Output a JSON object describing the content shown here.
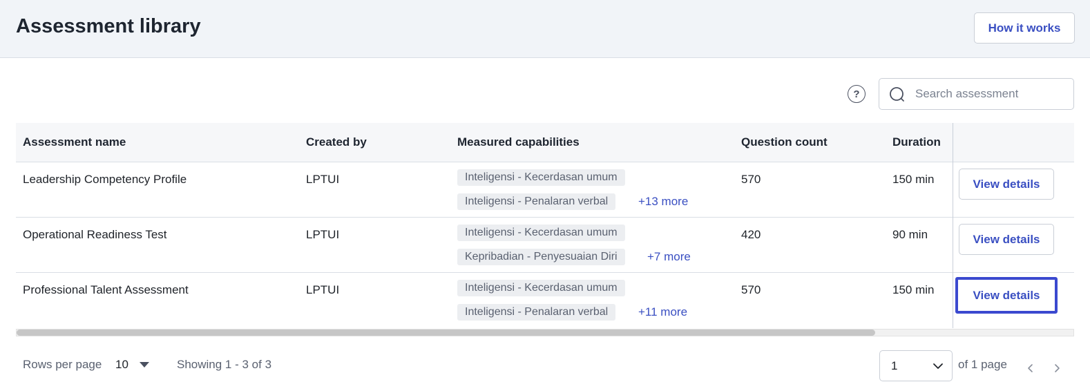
{
  "header": {
    "title": "Assessment library",
    "how_it_works": "How it works"
  },
  "toolbar": {
    "help_glyph": "?",
    "search_placeholder": "Search assessment"
  },
  "table": {
    "columns": [
      "Assessment name",
      "Created by",
      "Measured capabilities",
      "Question count",
      "Duration"
    ],
    "rows": [
      {
        "name": "Leadership Competency Profile",
        "created_by": "LPTUI",
        "capabilities": [
          "Inteligensi - Kecerdasan umum",
          "Inteligensi - Penalaran verbal"
        ],
        "more": "+13 more",
        "question_count": "570",
        "duration": "150 min",
        "action": "View details"
      },
      {
        "name": "Operational Readiness Test",
        "created_by": "LPTUI",
        "capabilities": [
          "Inteligensi - Kecerdasan umum",
          "Kepribadian - Penyesuaian Diri"
        ],
        "more": "+7 more",
        "question_count": "420",
        "duration": "90 min",
        "action": "View details"
      },
      {
        "name": "Professional Talent Assessment",
        "created_by": "LPTUI",
        "capabilities": [
          "Inteligensi - Kecerdasan umum",
          "Inteligensi - Penalaran verbal"
        ],
        "more": "+11 more",
        "question_count": "570",
        "duration": "150 min",
        "action": "View details"
      }
    ]
  },
  "footer": {
    "rows_per_page_label": "Rows per page",
    "rows_per_page_value": "10",
    "showing": "Showing 1 - 3 of 3",
    "page_value": "1",
    "of_pages": "of 1 page"
  },
  "colors": {
    "accent": "#3a4fc2",
    "focus_ring": "#3b49cf",
    "header_bg": "#f1f4f8"
  },
  "icons": {
    "help": "help-circle-icon",
    "search": "search-icon",
    "rows_caret": "caret-down-icon",
    "page_chevron": "chevron-down-icon",
    "prev": "chevron-left-icon",
    "next": "chevron-right-icon"
  }
}
